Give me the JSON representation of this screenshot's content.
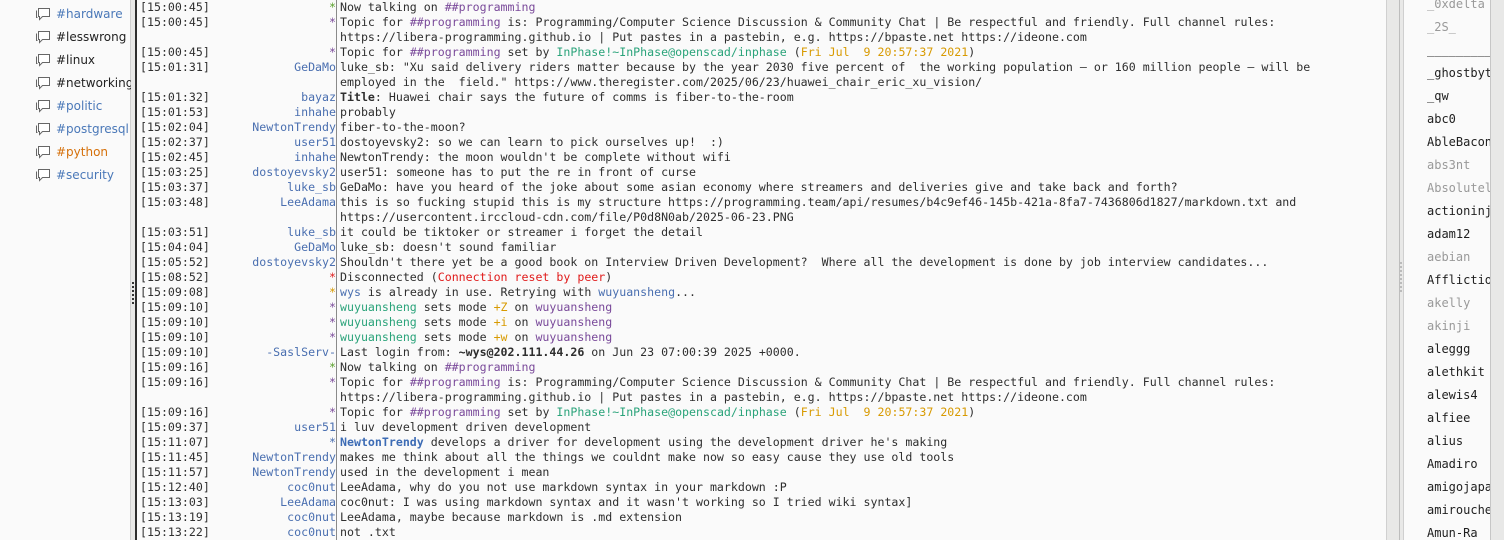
{
  "sidebar": {
    "channels": [
      {
        "label": "#hardware",
        "color": "#4a78b8"
      },
      {
        "label": "#lesswrong",
        "color": "#222222"
      },
      {
        "label": "#linux",
        "color": "#222222"
      },
      {
        "label": "#networking",
        "color": "#222222"
      },
      {
        "label": "#politic",
        "color": "#4a78b8"
      },
      {
        "label": "#postgresql",
        "color": "#4a78b8"
      },
      {
        "label": "#python",
        "color": "#d5700a"
      },
      {
        "label": "#security",
        "color": "#4a78b8"
      }
    ]
  },
  "chat": {
    "lines": [
      {
        "ts": "[15:00:45]",
        "nick": "*",
        "nc": "c-sg",
        "msg": [
          {
            "t": "Now talking on "
          },
          {
            "t": "##programming",
            "c": "c-ch"
          }
        ]
      },
      {
        "ts": "[15:00:45]",
        "nick": "*",
        "nc": "c-pu",
        "msg": [
          {
            "t": "Topic for "
          },
          {
            "t": "##programming",
            "c": "c-ch"
          },
          {
            "t": " is: Programming/Computer Science Discussion & Community Chat | Be respectful and friendly. Full channel rules:"
          }
        ]
      },
      {
        "ts": "",
        "nick": "",
        "msg": [
          {
            "t": "https://libera-programming.github.io | Put pastes in a pastebin, e.g. https://bpaste.net https://ideone.com"
          }
        ]
      },
      {
        "ts": "[15:00:45]",
        "nick": "*",
        "nc": "c-pu",
        "msg": [
          {
            "t": "Topic for "
          },
          {
            "t": "##programming",
            "c": "c-ch"
          },
          {
            "t": " set by "
          },
          {
            "t": "InPhase!~InPhase@openscad/inphase",
            "c": "c-gr"
          },
          {
            "t": " ("
          },
          {
            "t": "Fri Jul  9 20:57:37 2021",
            "c": "c-or"
          },
          {
            "t": ")"
          }
        ]
      },
      {
        "ts": "[15:01:31]",
        "nick": "GeDaMo",
        "msg": [
          {
            "t": "luke_sb: \"Xu said delivery riders matter because by the year 2030 five percent of  the working population — or 160 million people — will be"
          }
        ]
      },
      {
        "ts": "",
        "nick": "",
        "msg": [
          {
            "t": "employed in the  field.\" https://www.theregister.com/2025/06/23/huawei_chair_eric_xu_vision/"
          }
        ]
      },
      {
        "ts": "[15:01:32]",
        "nick": "bayaz",
        "msg": [
          {
            "t": "Title",
            "c": "c-b"
          },
          {
            "t": ": Huawei chair says the future of comms is fiber-to-the-room"
          }
        ]
      },
      {
        "ts": "[15:01:53]",
        "nick": "inhahe",
        "msg": [
          {
            "t": "probably"
          }
        ]
      },
      {
        "ts": "[15:02:04]",
        "nick": "NewtonTrendy",
        "msg": [
          {
            "t": "fiber-to-the-moon?"
          }
        ]
      },
      {
        "ts": "[15:02:37]",
        "nick": "user51",
        "msg": [
          {
            "t": "dostoyevsky2: so we can learn to pick ourselves up!  :)"
          }
        ]
      },
      {
        "ts": "[15:02:45]",
        "nick": "inhahe",
        "msg": [
          {
            "t": "NewtonTrendy: the moon wouldn't be complete without wifi"
          }
        ]
      },
      {
        "ts": "[15:03:25]",
        "nick": "dostoyevsky2",
        "msg": [
          {
            "t": "user51: someone has to put the re in front of curse"
          }
        ]
      },
      {
        "ts": "[15:03:37]",
        "nick": "luke_sb",
        "msg": [
          {
            "t": "GeDaMo: have you heard of the joke about some asian economy where streamers and deliveries give and take back and forth?"
          }
        ]
      },
      {
        "ts": "[15:03:48]",
        "nick": "LeeAdama",
        "msg": [
          {
            "t": "this is so fucking stupid this is my structure https://programming.team/api/resumes/b4c9ef46-145b-421a-8fa7-7436806d1827/markdown.txt and"
          }
        ]
      },
      {
        "ts": "",
        "nick": "",
        "msg": [
          {
            "t": "https://usercontent.irccloud-cdn.com/file/P0d8N0ab/2025-06-23.PNG"
          }
        ]
      },
      {
        "ts": "[15:03:51]",
        "nick": "luke_sb",
        "msg": [
          {
            "t": "it could be tiktoker or streamer i forget the detail"
          }
        ]
      },
      {
        "ts": "[15:04:04]",
        "nick": "GeDaMo",
        "msg": [
          {
            "t": "luke_sb: doesn't sound familiar"
          }
        ]
      },
      {
        "ts": "[15:05:52]",
        "nick": "dostoyevsky2",
        "msg": [
          {
            "t": "Shouldn't there yet be a good book on Interview Driven Development?  Where all the development is done by job interview candidates..."
          }
        ]
      },
      {
        "ts": "[15:08:52]",
        "nick": "*",
        "nc": "c-rd",
        "msg": [
          {
            "t": "Disconnected ("
          },
          {
            "t": "Connection reset by peer",
            "c": "c-rd"
          },
          {
            "t": ")"
          }
        ]
      },
      {
        "ts": "[15:09:08]",
        "nick": "*",
        "nc": "c-or",
        "msg": [
          {
            "t": "wys",
            "c": "c-nk"
          },
          {
            "t": " is already in use. Retrying with "
          },
          {
            "t": "wuyuansheng",
            "c": "c-nk"
          },
          {
            "t": "..."
          }
        ]
      },
      {
        "ts": "[15:09:10]",
        "nick": "*",
        "nc": "c-pu",
        "msg": [
          {
            "t": "wuyuansheng",
            "c": "c-gr"
          },
          {
            "t": " sets mode "
          },
          {
            "t": "+Z",
            "c": "c-or"
          },
          {
            "t": " on "
          },
          {
            "t": "wuyuansheng",
            "c": "c-pu"
          }
        ]
      },
      {
        "ts": "[15:09:10]",
        "nick": "*",
        "nc": "c-pu",
        "msg": [
          {
            "t": "wuyuansheng",
            "c": "c-gr"
          },
          {
            "t": " sets mode "
          },
          {
            "t": "+i",
            "c": "c-or"
          },
          {
            "t": " on "
          },
          {
            "t": "wuyuansheng",
            "c": "c-pu"
          }
        ]
      },
      {
        "ts": "[15:09:10]",
        "nick": "*",
        "nc": "c-pu",
        "msg": [
          {
            "t": "wuyuansheng",
            "c": "c-gr"
          },
          {
            "t": " sets mode "
          },
          {
            "t": "+w",
            "c": "c-or"
          },
          {
            "t": " on "
          },
          {
            "t": "wuyuansheng",
            "c": "c-pu"
          }
        ]
      },
      {
        "ts": "[15:09:10]",
        "nick": "-SaslServ-",
        "msg": [
          {
            "t": "Last login from: "
          },
          {
            "t": "~wys@202.111.44.26",
            "c": "c-b"
          },
          {
            "t": " on Jun 23 07:00:39 2025 +0000."
          }
        ]
      },
      {
        "ts": "[15:09:16]",
        "nick": "*",
        "nc": "c-sg",
        "msg": [
          {
            "t": "Now talking on "
          },
          {
            "t": "##programming",
            "c": "c-ch"
          }
        ]
      },
      {
        "ts": "[15:09:16]",
        "nick": "*",
        "nc": "c-pu",
        "msg": [
          {
            "t": "Topic for "
          },
          {
            "t": "##programming",
            "c": "c-ch"
          },
          {
            "t": " is: Programming/Computer Science Discussion & Community Chat | Be respectful and friendly. Full channel rules:"
          }
        ]
      },
      {
        "ts": "",
        "nick": "",
        "msg": [
          {
            "t": "https://libera-programming.github.io | Put pastes in a pastebin, e.g. https://bpaste.net https://ideone.com"
          }
        ]
      },
      {
        "ts": "[15:09:16]",
        "nick": "*",
        "nc": "c-pu",
        "msg": [
          {
            "t": "Topic for "
          },
          {
            "t": "##programming",
            "c": "c-ch"
          },
          {
            "t": " set by "
          },
          {
            "t": "InPhase!~InPhase@openscad/inphase",
            "c": "c-gr"
          },
          {
            "t": " ("
          },
          {
            "t": "Fri Jul  9 20:57:37 2021",
            "c": "c-or"
          },
          {
            "t": ")"
          }
        ]
      },
      {
        "ts": "[15:09:37]",
        "nick": "user51",
        "msg": [
          {
            "t": "i luv development driven development"
          }
        ]
      },
      {
        "ts": "[15:11:07]",
        "nick": "*",
        "nc": "c-nk",
        "msg": [
          {
            "t": "NewtonTrendy",
            "c": "c-bnk"
          },
          {
            "t": " develops a driver for development using the development driver he's making"
          }
        ]
      },
      {
        "ts": "[15:11:45]",
        "nick": "NewtonTrendy",
        "msg": [
          {
            "t": "makes me think about all the things we couldnt make now so easy cause they use old tools"
          }
        ]
      },
      {
        "ts": "[15:11:57]",
        "nick": "NewtonTrendy",
        "msg": [
          {
            "t": "used in the development i mean"
          }
        ]
      },
      {
        "ts": "[15:12:40]",
        "nick": "coc0nut",
        "msg": [
          {
            "t": "LeeAdama, why do you not use markdown syntax in your markdown :P"
          }
        ]
      },
      {
        "ts": "[15:13:03]",
        "nick": "LeeAdama",
        "msg": [
          {
            "t": "coc0nut: I was using markdown syntax and it wasn't working so I tried wiki syntax]"
          }
        ]
      },
      {
        "ts": "[15:13:19]",
        "nick": "coc0nut",
        "msg": [
          {
            "t": "LeeAdama, maybe because markdown is .md extension"
          }
        ]
      },
      {
        "ts": "[15:13:22]",
        "nick": "coc0nut",
        "msg": [
          {
            "t": "not .txt"
          }
        ]
      }
    ]
  },
  "userlist": {
    "users": [
      {
        "n": "_0xdelta",
        "away": true
      },
      {
        "n": "_2S_",
        "away": true
      },
      {
        "n": "__________",
        "away": false
      },
      {
        "n": "_ghostbyt",
        "away": false
      },
      {
        "n": "_qw",
        "away": false
      },
      {
        "n": "abc0",
        "away": false
      },
      {
        "n": "AbleBacon",
        "away": false
      },
      {
        "n": "abs3nt",
        "away": true
      },
      {
        "n": "Absolutel",
        "away": true
      },
      {
        "n": "actioninj",
        "away": false
      },
      {
        "n": "adam12",
        "away": false
      },
      {
        "n": "aebian",
        "away": true
      },
      {
        "n": "Afflictio",
        "away": false
      },
      {
        "n": "akelly",
        "away": true
      },
      {
        "n": "akinji",
        "away": true
      },
      {
        "n": "aleggg",
        "away": false
      },
      {
        "n": "alethkit",
        "away": false
      },
      {
        "n": "alewis4",
        "away": false
      },
      {
        "n": "alfiee",
        "away": false
      },
      {
        "n": "alius",
        "away": false
      },
      {
        "n": "Amadiro",
        "away": false
      },
      {
        "n": "amigojapa",
        "away": false
      },
      {
        "n": "amirouche",
        "away": false
      },
      {
        "n": "Amun-Ra",
        "away": false
      }
    ]
  }
}
